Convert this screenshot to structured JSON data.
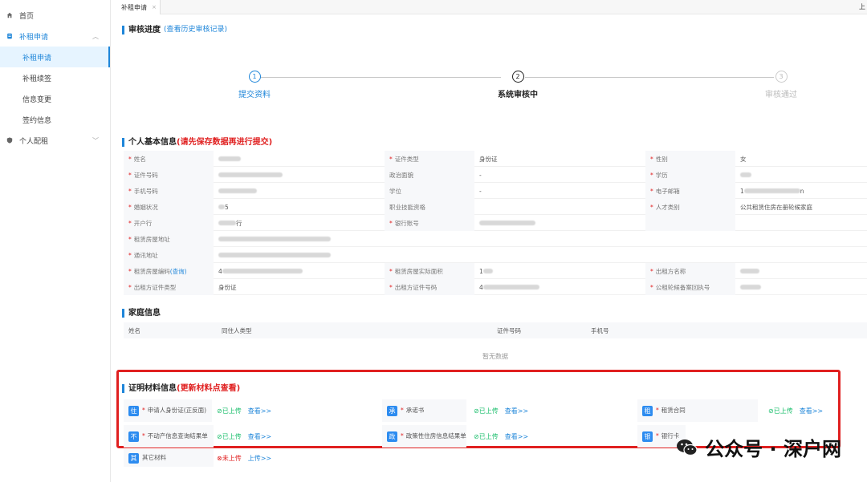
{
  "sidebar": {
    "items": [
      {
        "label": "首页",
        "icon": "home-icon"
      },
      {
        "label": "补租申请",
        "icon": "document-icon"
      },
      {
        "label": "补租申请"
      },
      {
        "label": "补租续签"
      },
      {
        "label": "信息变更"
      },
      {
        "label": "签约信息"
      },
      {
        "label": "个人配租",
        "icon": "shield-icon"
      }
    ]
  },
  "tabs": [
    {
      "label": "补租申请",
      "close": "×"
    }
  ],
  "tab_end": "上",
  "progress": {
    "title": "审核进度",
    "history_link": "(查看历史审核记录)",
    "steps": [
      {
        "num": "1",
        "label": "提交资料"
      },
      {
        "num": "2",
        "label": "系统审核中"
      },
      {
        "num": "3",
        "label": "审核通过"
      }
    ]
  },
  "basic": {
    "title": "个人基本信息",
    "note": "(请先保存数据再进行提交)",
    "labels": {
      "name": "姓名",
      "id_type": "证件类型",
      "gender": "性别",
      "id_no": "证件号码",
      "politics": "政治面貌",
      "education": "学历",
      "phone": "手机号码",
      "degree": "学位",
      "email": "电子邮箱",
      "marital": "婚姻状况",
      "qualification": "职业技能资格",
      "talent": "人才类别",
      "bank": "开户行",
      "account": "银行账号",
      "rent_addr": "租赁房屋地址",
      "mail_addr": "通讯地址",
      "house_no": "租赁房屋编码",
      "house_no_link": "(查询)",
      "area": "租赁房屋实际面积",
      "lessor": "出租方名称",
      "lessor_id_type": "出租方证件类型",
      "lessor_id_no": "出租方证件号码",
      "record_no": "公租轮候备案回执号"
    },
    "values": {
      "id_type": "身份证",
      "gender": "女",
      "politics": "-",
      "degree": "-",
      "email_partial": "1",
      "email_end": "n",
      "marital_partial": "5",
      "talent": "公共租赁住房在册轮候家庭",
      "bank_partial": "行",
      "house_no_partial": "4",
      "area_partial": "1",
      "lessor_id_type": "身份证",
      "lessor_id_partial": "4"
    }
  },
  "family": {
    "title": "家庭信息",
    "columns": [
      "姓名",
      "同住人类型",
      "证件号码",
      "手机号"
    ],
    "empty": "暂无数据"
  },
  "materials": {
    "title": "证明材料信息",
    "note": "(更新材料点查看)",
    "items": [
      {
        "tag": "住",
        "label": "申请人身份证(正反面)",
        "status": "已上传",
        "action": "查看>>"
      },
      {
        "tag": "承",
        "label": "承诺书",
        "status": "已上传",
        "action": "查看>>"
      },
      {
        "tag": "租",
        "label": "租赁合同",
        "status": "已上传",
        "action": "查看>>"
      },
      {
        "tag": "不",
        "label": "不动产信息查询结果单",
        "status": "已上传",
        "action": "查看>>"
      },
      {
        "tag": "政",
        "label": "政策性住房信息结果单",
        "status": "已上传",
        "action": "查看>>"
      },
      {
        "tag": "银",
        "label": "银行卡",
        "status": "",
        "action": ""
      },
      {
        "tag": "其",
        "label": "其它材料",
        "status": "未上传",
        "action": "上传>>"
      }
    ]
  },
  "watermark": {
    "text": "公众号 · 深户网"
  },
  "colors": {
    "accent": "#1f86d9",
    "red": "#e02020",
    "green": "#19be6b",
    "tag": "#2d8cf0"
  }
}
